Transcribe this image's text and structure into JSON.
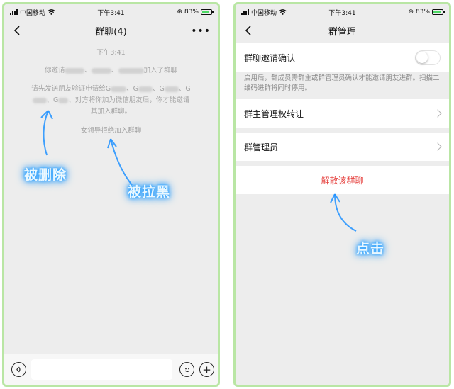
{
  "status_bar": {
    "carrier": "中国移动",
    "time": "下午3:41",
    "battery": "83%"
  },
  "left_phone": {
    "title": "群聊(4)",
    "messages": {
      "time": "下午3:41",
      "invite_prefix": "你邀请",
      "invite_suffix": "加入了群聊",
      "verify_line1_prefix": "请先发送朋友验证申请给",
      "g1": "G",
      "g2": "、G",
      "g3": "、G",
      "g4": "、G",
      "verify_line2_suffix": "、对方将你加为微信朋友后，你才能邀请",
      "verify_line3": "其加入群聊。",
      "rejected": "女领导拒绝加入群聊"
    }
  },
  "right_phone": {
    "title": "群管理",
    "invite_confirm_label": "群聊邀请确认",
    "invite_confirm_on": false,
    "description": "启用后，群成员需群主或群管理员确认才能邀请朋友进群。扫描二维码进群将同时停用。",
    "transfer_owner_label": "群主管理权转让",
    "admins_label": "群管理员",
    "dissolve_label": "解散该群聊"
  },
  "annotations": {
    "deleted": "被删除",
    "blocked": "被拉黑",
    "click": "点击"
  },
  "colors": {
    "frame": "#b9e6a4",
    "danger": "#e64340",
    "glow": "#3aa8ff"
  }
}
